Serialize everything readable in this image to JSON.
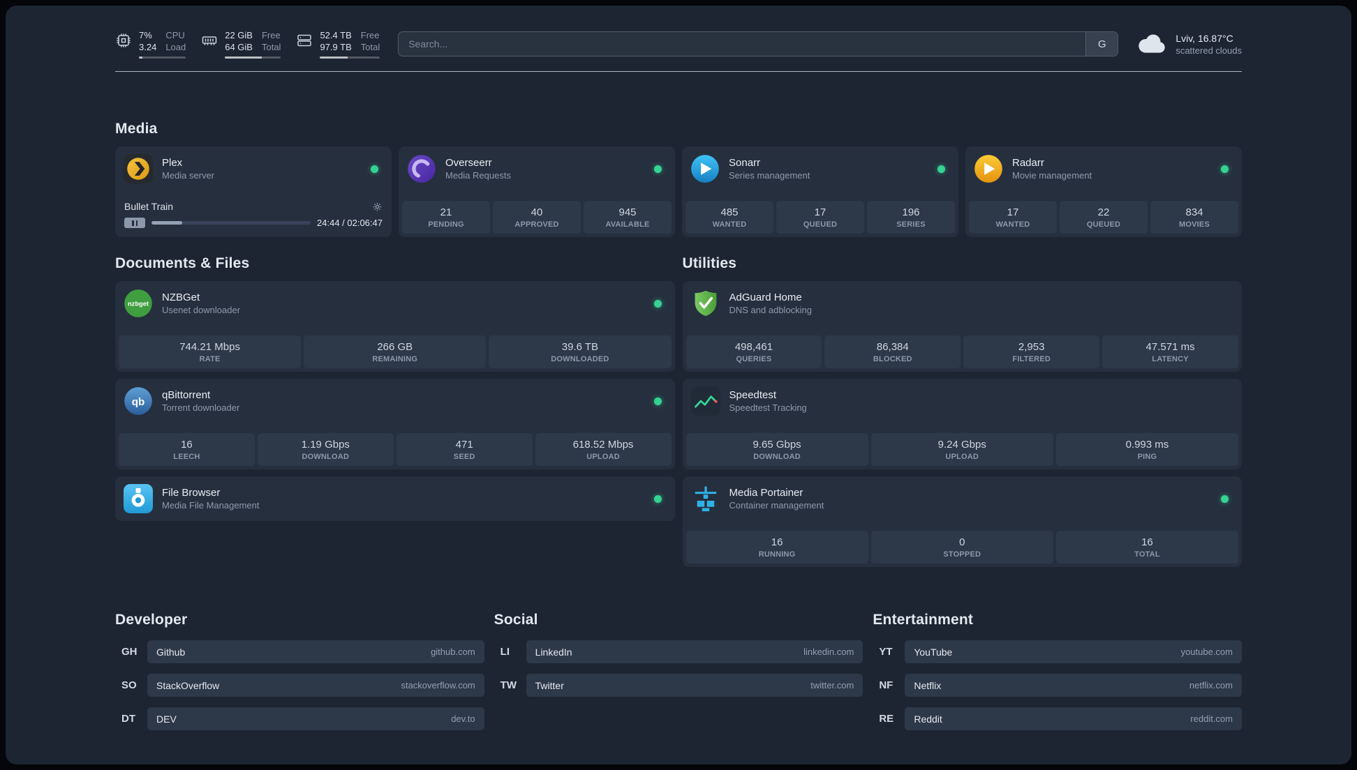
{
  "colors": {
    "background": "#1d2533",
    "card": "#262f3e",
    "stat_block": "#2d3848",
    "status_online": "#35d392"
  },
  "topbar": {
    "resources": [
      {
        "icon": "cpu-icon",
        "value_top": "7%",
        "value_bottom": "3.24",
        "label_top": "CPU",
        "label_bottom": "Load",
        "progress_pct": 7
      },
      {
        "icon": "memory-icon",
        "value_top": "22 GiB",
        "value_bottom": "64 GiB",
        "label_top": "Free",
        "label_bottom": "Total",
        "progress_pct": 66
      },
      {
        "icon": "disk-icon",
        "value_top": "52.4 TB",
        "value_bottom": "97.9 TB",
        "label_top": "Free",
        "label_bottom": "Total",
        "progress_pct": 46
      }
    ],
    "search": {
      "placeholder": "Search...",
      "provider_label": "G"
    },
    "weather": {
      "icon": "cloud-icon",
      "line1": "Lviv, 16.87°C",
      "line2": "scattered clouds"
    }
  },
  "media": {
    "title": "Media",
    "services": [
      {
        "icon": "plex-icon",
        "name": "Plex",
        "desc": "Media server",
        "online": true,
        "player": {
          "title": "Bullet Train",
          "time": "24:44 / 02:06:47",
          "progress_pct": 19.5
        }
      },
      {
        "icon": "overseerr-icon",
        "name": "Overseerr",
        "desc": "Media Requests",
        "online": true,
        "stats": [
          {
            "value": "21",
            "label": "PENDING"
          },
          {
            "value": "40",
            "label": "APPROVED"
          },
          {
            "value": "945",
            "label": "AVAILABLE"
          }
        ]
      },
      {
        "icon": "sonarr-icon",
        "name": "Sonarr",
        "desc": "Series management",
        "online": true,
        "stats": [
          {
            "value": "485",
            "label": "WANTED"
          },
          {
            "value": "17",
            "label": "QUEUED"
          },
          {
            "value": "196",
            "label": "SERIES"
          }
        ]
      },
      {
        "icon": "radarr-icon",
        "name": "Radarr",
        "desc": "Movie management",
        "online": true,
        "stats": [
          {
            "value": "17",
            "label": "WANTED"
          },
          {
            "value": "22",
            "label": "QUEUED"
          },
          {
            "value": "834",
            "label": "MOVIES"
          }
        ]
      }
    ]
  },
  "documents": {
    "title": "Documents & Files",
    "services": [
      {
        "icon": "nzbget-icon",
        "name": "NZBGet",
        "desc": "Usenet downloader",
        "online": true,
        "stats": [
          {
            "value": "744.21 Mbps",
            "label": "RATE"
          },
          {
            "value": "266 GB",
            "label": "REMAINING"
          },
          {
            "value": "39.6 TB",
            "label": "DOWNLOADED"
          }
        ]
      },
      {
        "icon": "qbittorrent-icon",
        "name": "qBittorrent",
        "desc": "Torrent downloader",
        "online": true,
        "stats": [
          {
            "value": "16",
            "label": "LEECH"
          },
          {
            "value": "1.19 Gbps",
            "label": "DOWNLOAD"
          },
          {
            "value": "471",
            "label": "SEED"
          },
          {
            "value": "618.52 Mbps",
            "label": "UPLOAD"
          }
        ]
      },
      {
        "icon": "filebrowser-icon",
        "name": "File Browser",
        "desc": "Media File Management",
        "online": true
      }
    ]
  },
  "utilities": {
    "title": "Utilities",
    "services": [
      {
        "icon": "adguard-icon",
        "name": "AdGuard Home",
        "desc": "DNS and adblocking",
        "stats": [
          {
            "value": "498,461",
            "label": "QUERIES"
          },
          {
            "value": "86,384",
            "label": "BLOCKED"
          },
          {
            "value": "2,953",
            "label": "FILTERED"
          },
          {
            "value": "47.571 ms",
            "label": "LATENCY"
          }
        ]
      },
      {
        "icon": "speedtest-icon",
        "name": "Speedtest",
        "desc": "Speedtest Tracking",
        "stats": [
          {
            "value": "9.65 Gbps",
            "label": "DOWNLOAD"
          },
          {
            "value": "9.24 Gbps",
            "label": "UPLOAD"
          },
          {
            "value": "0.993 ms",
            "label": "PING"
          }
        ]
      },
      {
        "icon": "portainer-icon",
        "name": "Media Portainer",
        "desc": "Container management",
        "online": true,
        "stats": [
          {
            "value": "16",
            "label": "RUNNING"
          },
          {
            "value": "0",
            "label": "STOPPED"
          },
          {
            "value": "16",
            "label": "TOTAL"
          }
        ]
      }
    ]
  },
  "bookmark_groups": [
    {
      "title": "Developer",
      "items": [
        {
          "abbr": "GH",
          "name": "Github",
          "url": "github.com"
        },
        {
          "abbr": "SO",
          "name": "StackOverflow",
          "url": "stackoverflow.com"
        },
        {
          "abbr": "DT",
          "name": "DEV",
          "url": "dev.to"
        }
      ]
    },
    {
      "title": "Social",
      "items": [
        {
          "abbr": "LI",
          "name": "LinkedIn",
          "url": "linkedin.com"
        },
        {
          "abbr": "TW",
          "name": "Twitter",
          "url": "twitter.com"
        }
      ]
    },
    {
      "title": "Entertainment",
      "items": [
        {
          "abbr": "YT",
          "name": "YouTube",
          "url": "youtube.com"
        },
        {
          "abbr": "NF",
          "name": "Netflix",
          "url": "netflix.com"
        },
        {
          "abbr": "RE",
          "name": "Reddit",
          "url": "reddit.com"
        }
      ]
    }
  ]
}
